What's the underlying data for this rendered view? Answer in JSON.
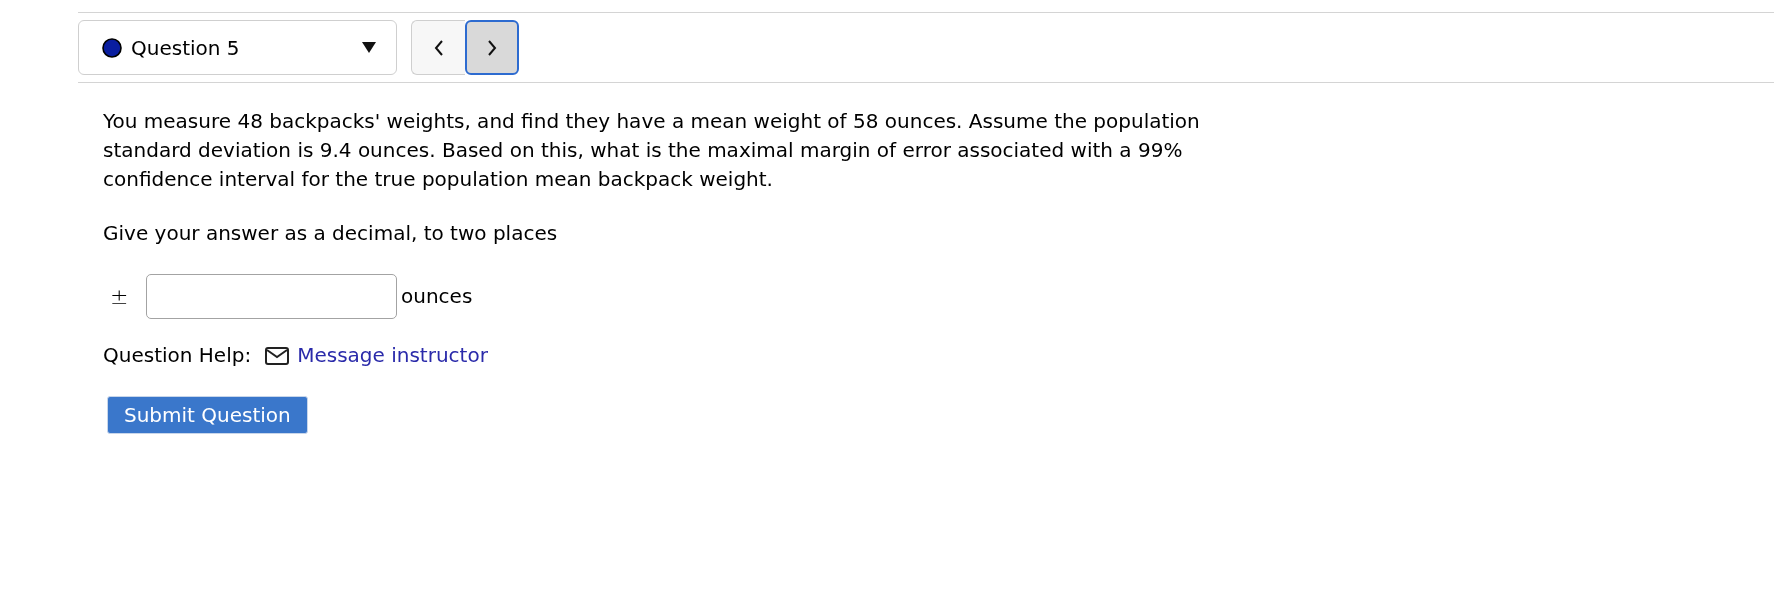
{
  "question_select": {
    "label": "Question 5"
  },
  "nav_buttons": [
    {
      "kind": "previous",
      "focused": false
    },
    {
      "kind": "next",
      "focused": true
    }
  ],
  "question": {
    "text": "You measure 48 backpacks' weights, and find they have a mean weight of 58 ounces. Assume the population standard deviation is 9.4 ounces. Based on this, what is the maximal margin of error associated with a 99% confidence interval for the true population mean backpack weight.",
    "instruction": "Give your answer as a decimal, to two places"
  },
  "answer": {
    "prefix": "±",
    "unit": "ounces"
  },
  "question_help": {
    "label": "Question Help:",
    "link": "Message instructor"
  },
  "submit_button": {
    "label": "Submit Question"
  }
}
